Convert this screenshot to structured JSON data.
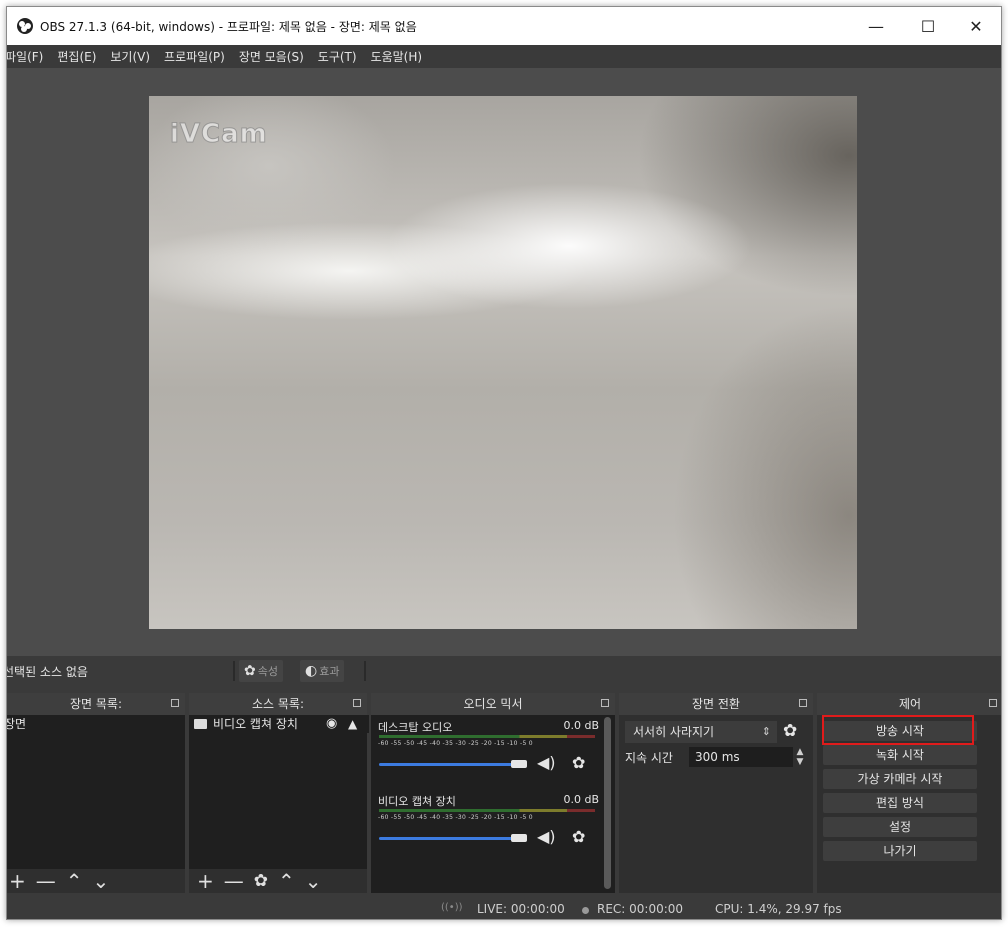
{
  "window": {
    "title": "OBS 27.1.3 (64-bit, windows) - 프로파일: 제목 없음 - 장면: 제목 없음",
    "minimize": "—",
    "maximize": "☐",
    "close": "✕"
  },
  "menubar": {
    "items": [
      "파일(F)",
      "편집(E)",
      "보기(V)",
      "프로파일(P)",
      "장면 모음(S)",
      "도구(T)",
      "도움말(H)"
    ]
  },
  "preview": {
    "watermark": "iVCam"
  },
  "source_toolbar": {
    "no_source_label": "선택된 소스 없음",
    "properties_label": "속성",
    "filters_label": "효과"
  },
  "scenes": {
    "title": "장면 목록:",
    "items": [
      "장면"
    ]
  },
  "sources": {
    "title": "소스 목록:",
    "items": [
      "비디오 캡쳐 장치"
    ]
  },
  "mixer": {
    "title": "오디오 믹서",
    "tick_labels": "-60 -55 -50 -45 -40 -35 -30 -25 -20 -15 -10 -5 0",
    "channels": [
      {
        "name": "데스크탑 오디오",
        "db": "0.0 dB",
        "volume": 1.0
      },
      {
        "name": "비디오 캡쳐 장치",
        "db": "0.0 dB",
        "volume": 1.0
      }
    ]
  },
  "transitions": {
    "title": "장면 전환",
    "selected": "서서히 사라지기",
    "duration_label": "지속 시간",
    "duration_value": "300 ms"
  },
  "controls": {
    "title": "제어",
    "buttons": [
      "방송 시작",
      "녹화 시작",
      "가상 카메라 시작",
      "편집 방식",
      "설정",
      "나가기"
    ]
  },
  "status": {
    "live": "LIVE: 00:00:00",
    "rec": "REC: 00:00:00",
    "cpu": "CPU: 1.4%, 29.97 fps"
  },
  "colors": {
    "highlight": "#e01b1b",
    "slider": "#3c7be0",
    "panel": "#2f2f2f"
  }
}
